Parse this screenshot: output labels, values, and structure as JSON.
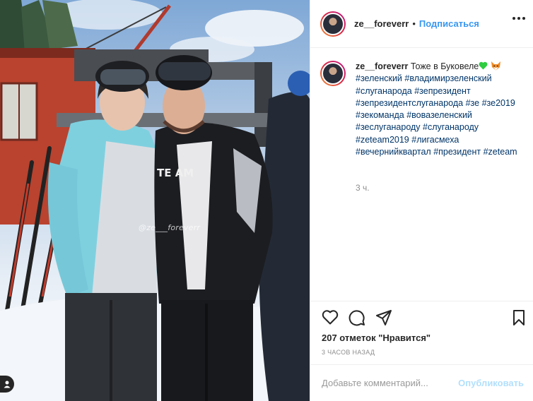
{
  "post": {
    "username": "ze__foreverr",
    "dot": "•",
    "follow_label": "Подписаться",
    "more_icon": "more-horizontal-icon",
    "photo_watermark": "@ze___foreverr",
    "caption": {
      "username": "ze__foreverr",
      "text": "Тоже в Буковеле",
      "emojis": [
        "green-heart-icon",
        "fox-face-icon"
      ],
      "hashtags": [
        "#зеленский",
        "#владимирзеленский",
        "#слуганарода",
        "#зепрезидент",
        "#зепрезидентслуганарода",
        "#зе",
        "#зе2019",
        "#зекоманда",
        "#вовазеленский",
        "#зеслуганароду",
        "#слуганароду",
        "#zeteam2019",
        "#лигасмеха",
        "#вечернийквартал",
        "#президент",
        "#zeteam"
      ],
      "time": "3 ч."
    },
    "likes": "207 отметок \"Нравится\"",
    "time_ago": "3 ЧАСОВ НАЗАД",
    "comment_placeholder": "Добавьте комментарий...",
    "publish_label": "Опубликовать"
  },
  "colors": {
    "link": "#003569",
    "follow": "#3897f0",
    "publish_disabled": "#b2dffc",
    "heart": "#2ecc40"
  }
}
